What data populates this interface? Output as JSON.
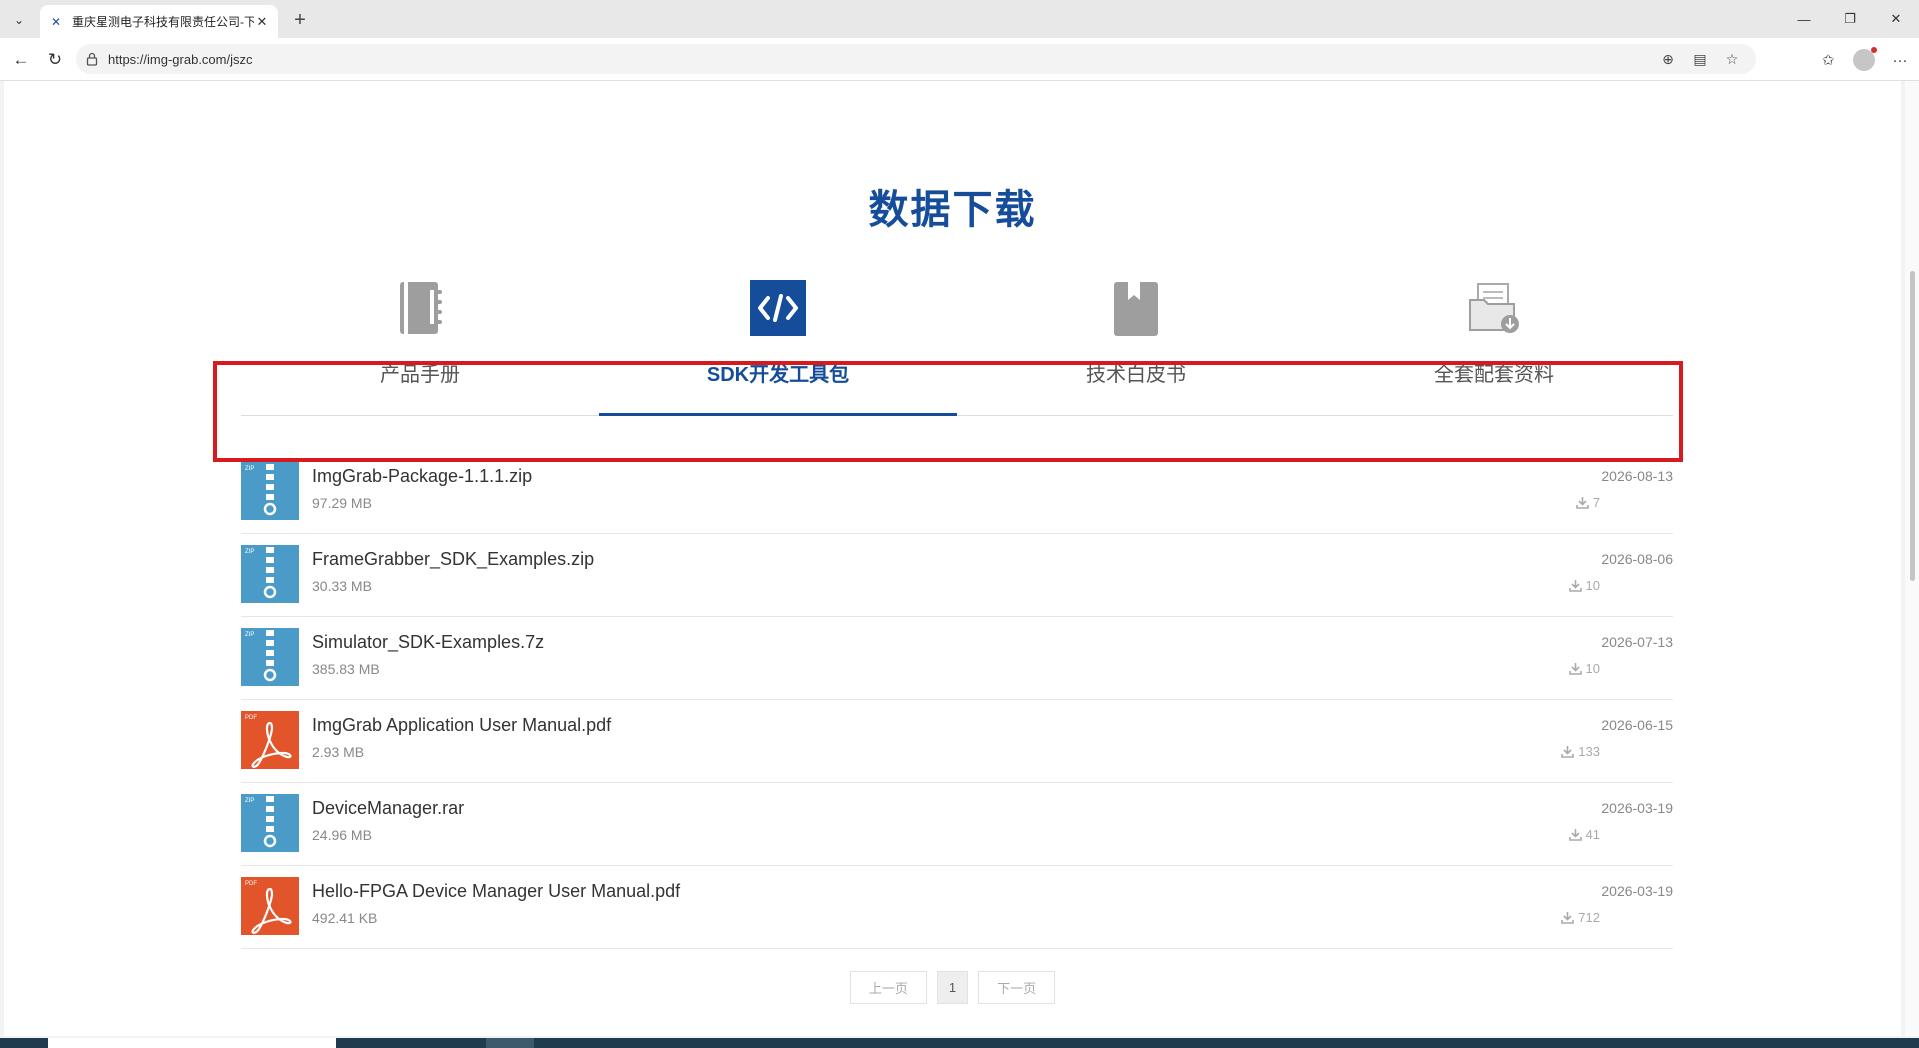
{
  "browser": {
    "tab_title": "重庆星测电子科技有限责任公司-下",
    "url": "https://img-grab.com/jszc"
  },
  "page": {
    "title": "数据下载",
    "tabs": [
      {
        "label": "产品手册",
        "icon": "notebook-icon",
        "active": false
      },
      {
        "label": "SDK开发工具包",
        "icon": "code-icon",
        "active": true
      },
      {
        "label": "技术白皮书",
        "icon": "bookmark-book-icon",
        "active": false
      },
      {
        "label": "全套配套资料",
        "icon": "folder-download-icon",
        "active": false
      }
    ],
    "files": [
      {
        "name": "ImgGrab-Package-1.1.1.zip",
        "size": "97.29 MB",
        "date": "2026-08-13",
        "downloads": "7",
        "type": "zip",
        "type_label": "ZIP"
      },
      {
        "name": "FrameGrabber_SDK_Examples.zip",
        "size": "30.33 MB",
        "date": "2026-08-06",
        "downloads": "10",
        "type": "zip",
        "type_label": "ZIP"
      },
      {
        "name": "Simulator_SDK-Examples.7z",
        "size": "385.83 MB",
        "date": "2026-07-13",
        "downloads": "10",
        "type": "zip",
        "type_label": "ZIP"
      },
      {
        "name": "ImgGrab Application User Manual.pdf",
        "size": "2.93 MB",
        "date": "2026-06-15",
        "downloads": "133",
        "type": "pdf",
        "type_label": "PDF"
      },
      {
        "name": "DeviceManager.rar",
        "size": "24.96 MB",
        "date": "2026-03-19",
        "downloads": "41",
        "type": "zip",
        "type_label": "ZIP"
      },
      {
        "name": "Hello-FPGA Device Manager User Manual.pdf",
        "size": "492.41 KB",
        "date": "2026-03-19",
        "downloads": "712",
        "type": "pdf",
        "type_label": "PDF"
      }
    ],
    "pager": {
      "prev": "上一页",
      "current": "1",
      "next": "下一页"
    }
  },
  "colors": {
    "brand_blue": "#154d9a",
    "zip_icon": "#4a9bc7",
    "pdf_icon": "#e2542a",
    "highlight": "#d71920"
  }
}
